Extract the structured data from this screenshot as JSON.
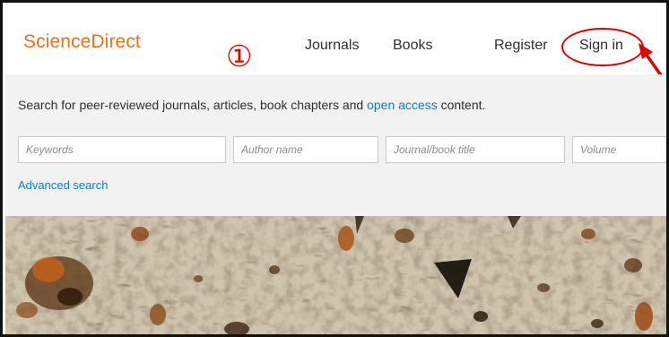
{
  "header": {
    "logo": "ScienceDirect",
    "annotation_badge": "①",
    "nav": {
      "journals": "Journals",
      "books": "Books",
      "register": "Register",
      "sign_in": "Sign in"
    }
  },
  "search": {
    "tagline_prefix": "Search for peer-reviewed journals, articles, book chapters and ",
    "tagline_link": "open access",
    "tagline_suffix": " content.",
    "fields": {
      "keywords_placeholder": "Keywords",
      "author_placeholder": "Author name",
      "journal_placeholder": "Journal/book title",
      "volume_placeholder": "Volume"
    },
    "advanced_search": "Advanced search"
  },
  "colors": {
    "brand": "#e9711c",
    "link": "#0c7dbb",
    "annotation": "#e10000"
  },
  "hero": {
    "image": "histology-micrograph"
  }
}
